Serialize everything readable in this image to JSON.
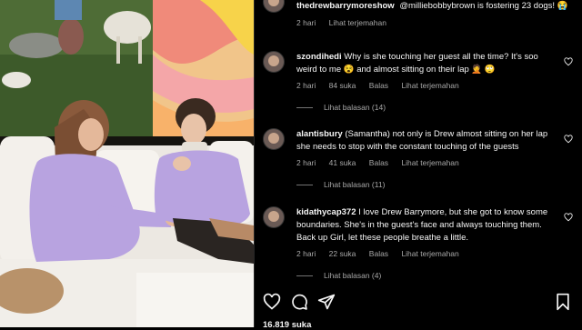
{
  "post": {
    "author": "thedrewbarrymoreshow",
    "caption": "@milliebobbybrown is fostering 23 dogs! 😭",
    "time": "2 hari",
    "translate": "Lihat terjemahan",
    "likes": "16.819 suka"
  },
  "comments": [
    {
      "username": "szondihedi",
      "text": "Why is she touching her guest all the time? It's soo weird to me 😵 and almost sitting on their lap 🤦 🙄",
      "time": "2 hari",
      "likes": "84 suka",
      "reply": "Balas",
      "translate": "Lihat terjemahan",
      "view_replies": "Lihat balasan (14)"
    },
    {
      "username": "alantisbury",
      "text": "(Samantha) not only is Drew almost sitting on her lap she needs to stop with the constant touching of the guests",
      "time": "2 hari",
      "likes": "41 suka",
      "reply": "Balas",
      "translate": "Lihat terjemahan",
      "view_replies": "Lihat balasan (11)"
    },
    {
      "username": "kidathycap372",
      "text": "I love Drew Barrymore, but she got to know some boundaries. She's in the guest's face and always touching them. Back up Girl, let these people breathe a little.",
      "time": "2 hari",
      "likes": "22 suka",
      "reply": "Balas",
      "translate": "Lihat terjemahan",
      "view_replies": "Lihat balasan (4)"
    }
  ],
  "icons": [
    "heart-icon",
    "comment-icon",
    "share-icon",
    "bookmark-icon"
  ],
  "colors": {
    "background": "#000000",
    "text": "#f5f5f5",
    "secondary": "#a8a8a8",
    "sweater": "#b8a3e0"
  }
}
